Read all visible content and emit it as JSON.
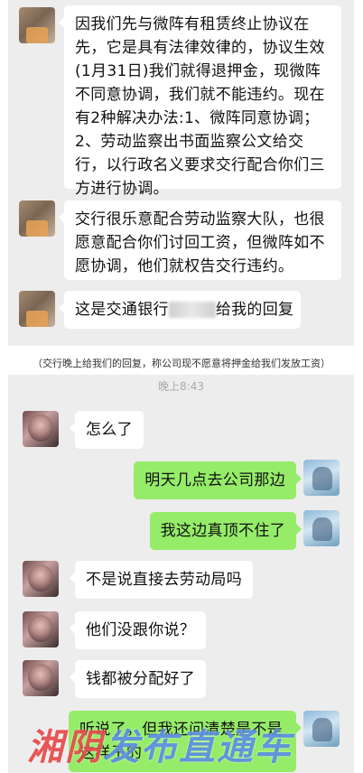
{
  "top_chat": {
    "messages": [
      {
        "side": "left",
        "text": "因我们先与微阵有租赁终止协议在先，它是具有法律效律的，协议生效(1月31日)我们就得退押金，现微阵不同意协调，我们就不能违约。现在有2种解决办法:1、微阵同意协调；2、劳动监察出书面监察公文给交行，以行政名义要求交行配合你们三方进行协调。"
      },
      {
        "side": "left",
        "text": "交行很乐意配合劳动监察大队，也很愿意配合你们讨回工资，但微阵如不愿协调，他们就权告交行违约。"
      },
      {
        "side": "left",
        "text_before": "这是交通银行",
        "text_after": "给我的回复"
      }
    ]
  },
  "caption": "（交行晚上给我们的回复，称公司现不愿意将押金给我们发放工资）",
  "bottom_chat": {
    "time": "晚上8:43",
    "messages": [
      {
        "side": "left",
        "text": "怎么了"
      },
      {
        "side": "right",
        "text": "明天几点去公司那边"
      },
      {
        "side": "right",
        "text": "我这边真顶不住了"
      },
      {
        "side": "left",
        "text": "不是说直接去劳动局吗"
      },
      {
        "side": "left",
        "text": "他们没跟你说？"
      },
      {
        "side": "left",
        "text": "钱都被分配好了"
      },
      {
        "side": "right",
        "text": "听说了，但我还问清楚是不是这样子的"
      }
    ]
  },
  "watermark": {
    "part1": "湘阴",
    "part2": "发布直通车"
  },
  "colors": {
    "chat_bg": "#ededed",
    "bubble_left": "#ffffff",
    "bubble_right": "#95ec69"
  }
}
